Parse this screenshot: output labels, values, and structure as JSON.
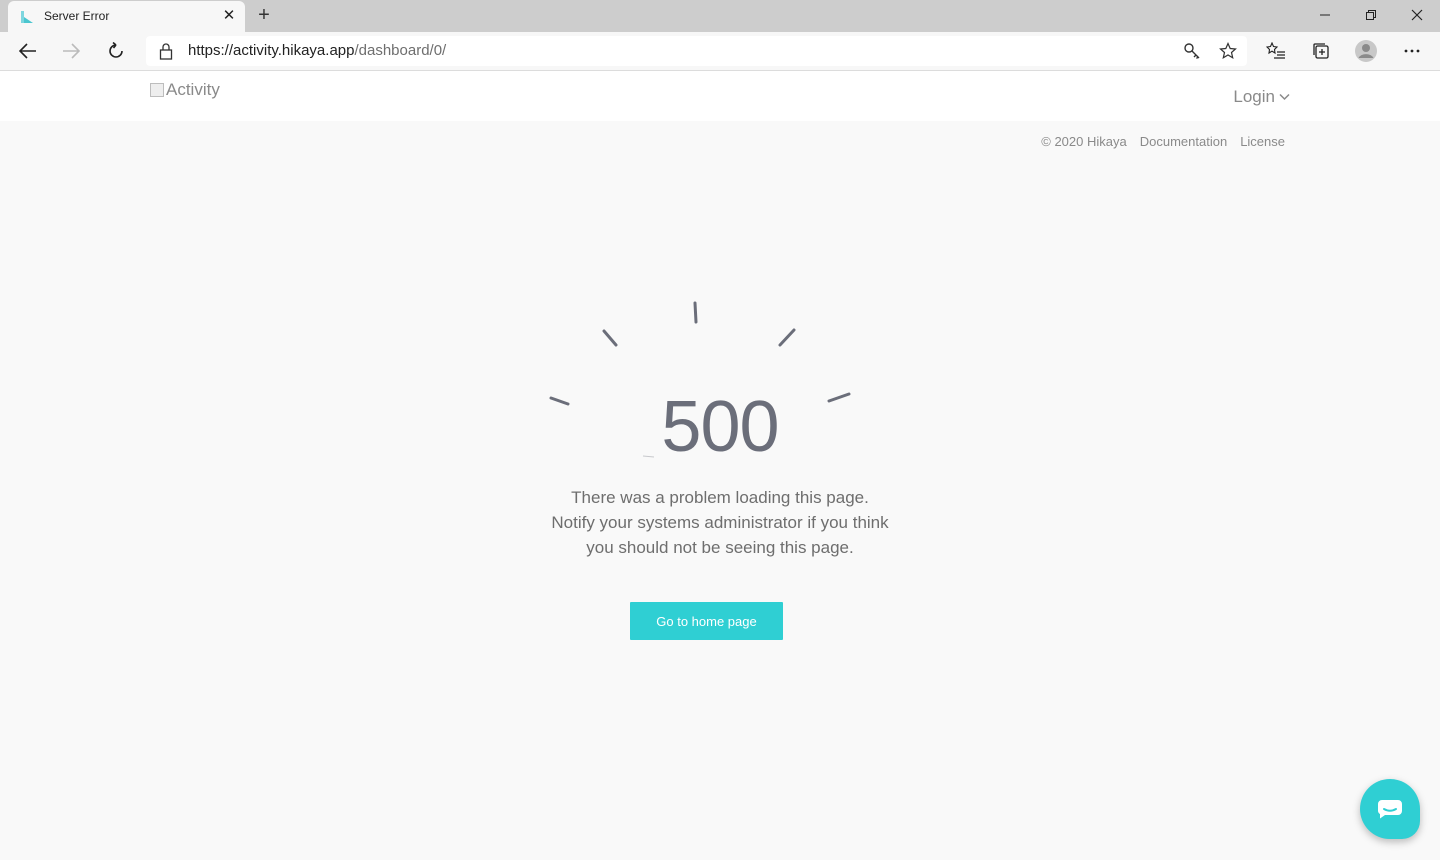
{
  "browser": {
    "tab_title": "Server Error",
    "url_base": "https://activity.hikaya.app",
    "url_path": "/dashboard/0/"
  },
  "header": {
    "logo_alt": "Activity",
    "login_label": "Login"
  },
  "footer": {
    "copyright": "© 2020 Hikaya",
    "documentation": "Documentation",
    "license": "License"
  },
  "error": {
    "code": "500",
    "lines": [
      "There was a problem loading this page.",
      "Notify your systems administrator if you think",
      "you should not be seeing this page."
    ],
    "button_label": "Go to home page"
  },
  "colors": {
    "accent": "#2fcfd3",
    "error_text": "#6b6e7a"
  }
}
